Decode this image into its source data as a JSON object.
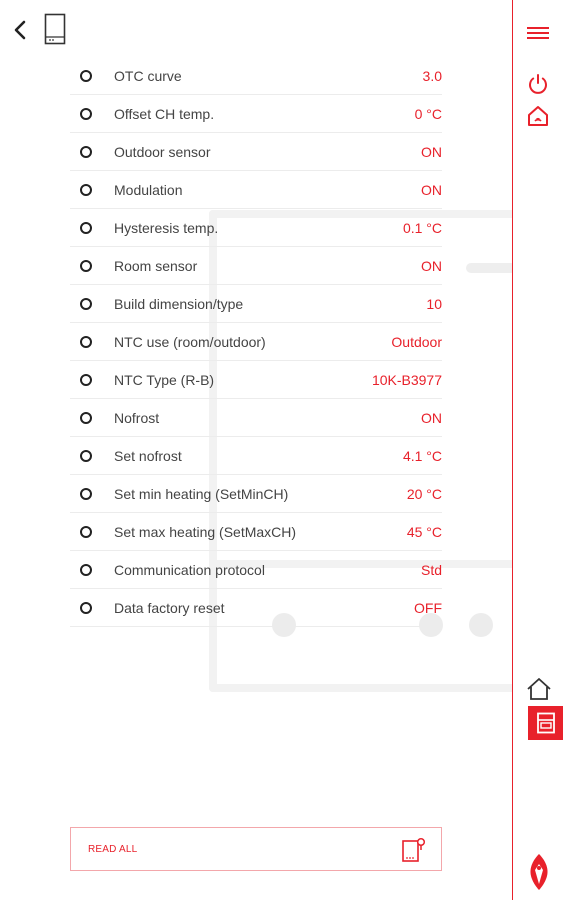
{
  "settings": [
    {
      "label": "OTC curve",
      "value": "3.0"
    },
    {
      "label": "Offset CH temp.",
      "value": "0 °C"
    },
    {
      "label": "Outdoor sensor",
      "value": "ON"
    },
    {
      "label": "Modulation",
      "value": "ON"
    },
    {
      "label": "Hysteresis temp.",
      "value": "0.1 °C"
    },
    {
      "label": "Room sensor",
      "value": "ON"
    },
    {
      "label": "Build dimension/type",
      "value": "10"
    },
    {
      "label": "NTC use (room/outdoor)",
      "value": "Outdoor"
    },
    {
      "label": "NTC Type (R-B)",
      "value": "10K-B3977"
    },
    {
      "label": "Nofrost",
      "value": "ON"
    },
    {
      "label": "Set nofrost",
      "value": "4.1 °C"
    },
    {
      "label": "Set min heating (SetMinCH)",
      "value": "20 °C"
    },
    {
      "label": "Set max heating (SetMaxCH)",
      "value": "45 °C"
    },
    {
      "label": "Communication protocol",
      "value": "Std"
    },
    {
      "label": "Data factory reset",
      "value": "OFF"
    }
  ],
  "footer": {
    "read_all_label": "READ ALL"
  },
  "icons": {
    "back": "chevron-left-icon",
    "device": "device-icon",
    "menu": "hamburger-menu-icon",
    "power": "power-icon",
    "home_remote": "home-remote-icon",
    "home": "home-icon",
    "boiler": "boiler-icon",
    "read_all": "device-read-icon",
    "logo": "brand-logo"
  },
  "colors": {
    "accent": "#e8212b",
    "text": "#444444",
    "divider": "#ececec"
  }
}
